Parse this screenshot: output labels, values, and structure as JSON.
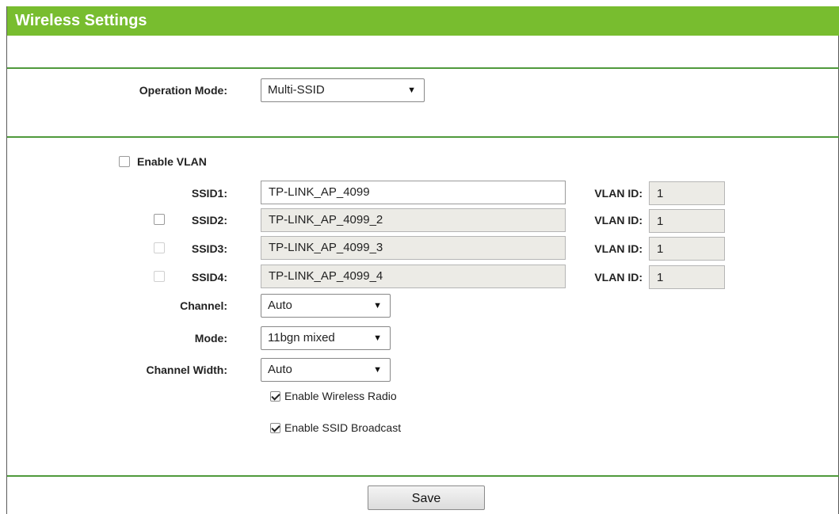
{
  "title": "Wireless Settings",
  "operation_mode": {
    "label": "Operation Mode:",
    "value": "Multi-SSID"
  },
  "vlan": {
    "label": "Enable VLAN",
    "checked": false
  },
  "ssids": [
    {
      "label": "SSID1:",
      "value": "TP-LINK_AP_4099",
      "vlan_label": "VLAN ID:",
      "vlan_value": "1"
    },
    {
      "label": "SSID2:",
      "value": "TP-LINK_AP_4099_2",
      "vlan_label": "VLAN ID:",
      "vlan_value": "1"
    },
    {
      "label": "SSID3:",
      "value": "TP-LINK_AP_4099_3",
      "vlan_label": "VLAN ID:",
      "vlan_value": "1"
    },
    {
      "label": "SSID4:",
      "value": "TP-LINK_AP_4099_4",
      "vlan_label": "VLAN ID:",
      "vlan_value": "1"
    }
  ],
  "channel": {
    "label": "Channel:",
    "value": "Auto"
  },
  "mode": {
    "label": "Mode:",
    "value": "11bgn mixed"
  },
  "channel_width": {
    "label": "Channel Width:",
    "value": "Auto"
  },
  "enable_wireless_radio": {
    "label": "Enable Wireless Radio",
    "checked": true
  },
  "enable_ssid_broadcast": {
    "label": "Enable SSID Broadcast",
    "checked": true
  },
  "save_label": "Save",
  "colors": {
    "title_bar": "#78bd2f",
    "divider": "#4f9a3c"
  }
}
